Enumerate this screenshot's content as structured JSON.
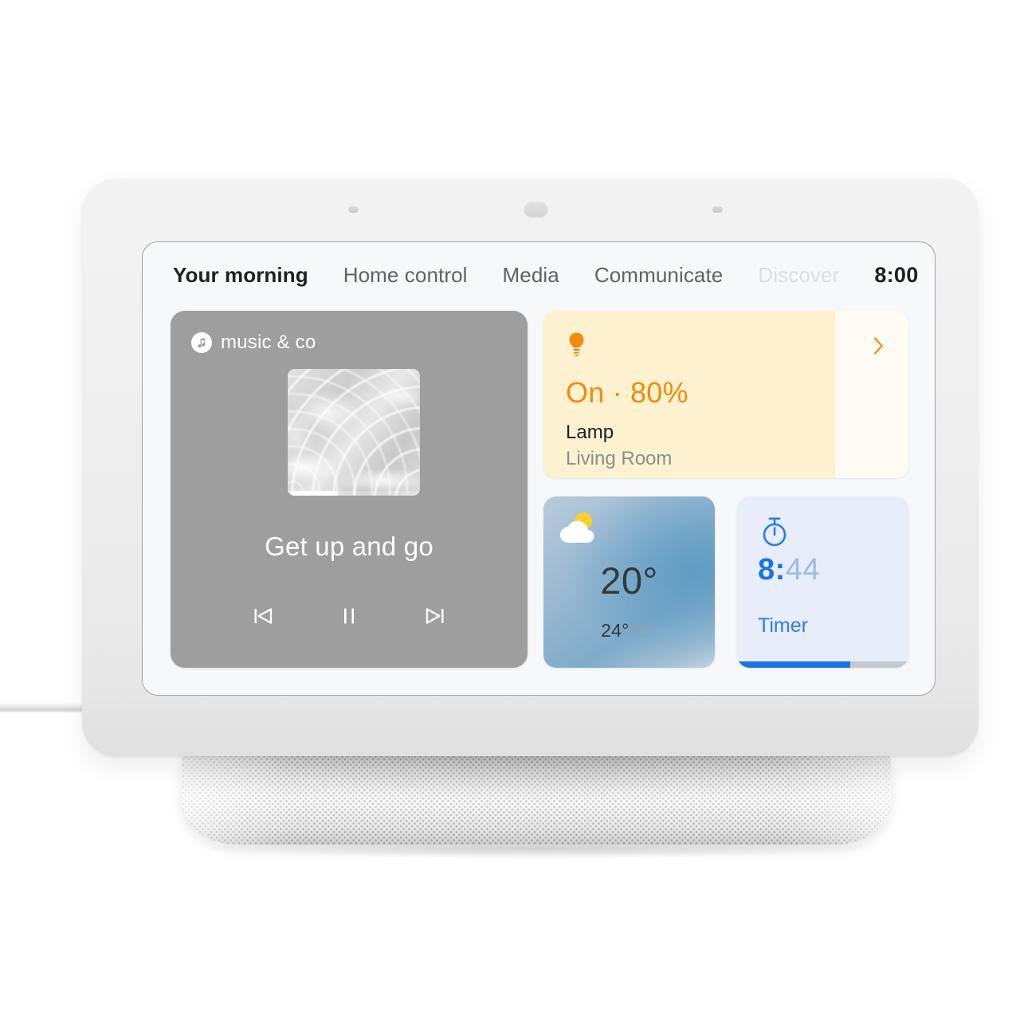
{
  "device": {
    "name": "smart-display",
    "bezel_color": "#efefef",
    "screen_bg": "#f7f8f9"
  },
  "tabs": [
    {
      "label": "Your morning",
      "state": "active"
    },
    {
      "label": "Home control",
      "state": "normal"
    },
    {
      "label": "Media",
      "state": "normal"
    },
    {
      "label": "Communicate",
      "state": "normal"
    },
    {
      "label": "Discover",
      "state": "muted"
    }
  ],
  "clock": "8:00",
  "music": {
    "app_name": "music & co",
    "app_icon": "music-note-icon",
    "album_art": "water-ripple-artwork",
    "track_title": "Get up and go",
    "progress_percent": 38,
    "controls": {
      "previous": "previous-track-icon",
      "play_pause": "pause-icon",
      "next": "next-track-icon"
    },
    "bg_color": "#9e9e9e"
  },
  "lamp": {
    "icon": "light-bulb-icon",
    "state": "On · 80%",
    "brightness_percent": 80,
    "name": "Lamp",
    "room": "Living Room",
    "chevron": "chevron-right-icon",
    "accent_color": "#ef8c10",
    "fill_color": "#fdf1cf",
    "track_color": "#fdfbf3"
  },
  "weather": {
    "icon": "partly-cloudy-icon",
    "current": "20°",
    "high": "24°",
    "low": "18°"
  },
  "timer": {
    "icon": "stopwatch-icon",
    "elapsed": "8:",
    "remaining": "44",
    "label": "Timer",
    "progress_percent": 66,
    "accent_color": "#1a73e8",
    "bg_color": "#e7edf9"
  }
}
